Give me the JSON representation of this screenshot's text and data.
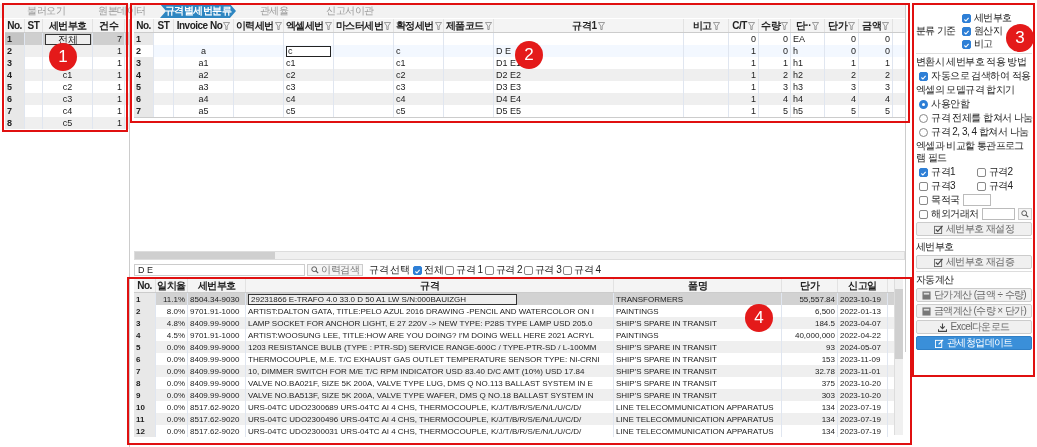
{
  "tabs": [
    {
      "label": "불러오기",
      "selected": false
    },
    {
      "label": "원본데이터",
      "selected": false
    },
    {
      "label": "규격별세번분류",
      "selected": true
    },
    {
      "label": "관세율",
      "selected": false
    },
    {
      "label": "신고서이관",
      "selected": false
    }
  ],
  "code_list": {
    "columns": [
      "No.",
      "ST",
      "세번부호",
      "건수"
    ],
    "rows": [
      {
        "no": "1",
        "code": "전체",
        "count": "7",
        "selected": true
      },
      {
        "no": "2",
        "count": "1",
        "selected": false
      },
      {
        "no": "3",
        "count": "1",
        "selected": false
      },
      {
        "no": "4",
        "code": "c1",
        "count": "1",
        "selected": false
      },
      {
        "no": "5",
        "code": "c2",
        "count": "1",
        "selected": false
      },
      {
        "no": "6",
        "code": "c3",
        "count": "1",
        "selected": false
      },
      {
        "no": "7",
        "code": "c4",
        "count": "1",
        "selected": false
      },
      {
        "no": "8",
        "code": "c5",
        "count": "1",
        "selected": false
      }
    ]
  },
  "items_table": {
    "columns": [
      {
        "label": "No.",
        "filter": false,
        "kind": "no"
      },
      {
        "label": "ST",
        "filter": false,
        "kind": "text"
      },
      {
        "label": "Invoice No",
        "filter": true,
        "kind": "center"
      },
      {
        "label": "이력세번",
        "filter": true,
        "kind": "text"
      },
      {
        "label": "엑셀세번",
        "filter": true,
        "kind": "edit"
      },
      {
        "label": "마스터세번",
        "filter": true,
        "kind": "text"
      },
      {
        "label": "확정세번",
        "filter": true,
        "kind": "text"
      },
      {
        "label": "제품코드",
        "filter": true,
        "kind": "text"
      },
      {
        "label": "규격1",
        "filter": true,
        "kind": "text"
      },
      {
        "label": "비고",
        "filter": true,
        "kind": "text"
      },
      {
        "label": "C/T",
        "filter": true,
        "kind": "number"
      },
      {
        "label": "수량",
        "filter": true,
        "kind": "number"
      },
      {
        "label": "단··",
        "filter": true,
        "kind": "text"
      },
      {
        "label": "단가",
        "filter": true,
        "kind": "number"
      },
      {
        "label": "금액",
        "filter": true,
        "kind": "number"
      }
    ],
    "rows": [
      {
        "selected": false,
        "cells": [
          "1",
          null,
          null,
          null,
          null,
          null,
          null,
          null,
          null,
          null,
          "0",
          "0",
          "EA",
          "0",
          "0"
        ]
      },
      {
        "selected": true,
        "cells": [
          "2",
          null,
          "a",
          null,
          "c",
          null,
          "c",
          null,
          "D E",
          null,
          "1",
          "0",
          "h",
          "0",
          "0"
        ]
      },
      {
        "selected": false,
        "cells": [
          "3",
          null,
          "a1",
          null,
          "c1",
          null,
          "c1",
          null,
          "D1 E1",
          null,
          "1",
          "1",
          "h1",
          "1",
          "1"
        ]
      },
      {
        "selected": false,
        "cells": [
          "4",
          null,
          "a2",
          null,
          "c2",
          null,
          "c2",
          null,
          "D2 E2",
          null,
          "1",
          "2",
          "h2",
          "2",
          "2"
        ]
      },
      {
        "selected": false,
        "cells": [
          "5",
          null,
          "a3",
          null,
          "c3",
          null,
          "c3",
          null,
          "D3 E3",
          null,
          "1",
          "3",
          "h3",
          "3",
          "3"
        ]
      },
      {
        "selected": false,
        "cells": [
          "6",
          null,
          "a4",
          null,
          "c4",
          null,
          "c4",
          null,
          "D4 E4",
          null,
          "1",
          "4",
          "h4",
          "4",
          "4"
        ]
      },
      {
        "selected": false,
        "cells": [
          "7",
          null,
          "a5",
          null,
          "c5",
          null,
          "c5",
          null,
          "D5 E5",
          null,
          "1",
          "5",
          "h5",
          "5",
          "5"
        ]
      }
    ]
  },
  "search": {
    "value": "D E",
    "button": "이력검색",
    "spec_label": "규격 선택",
    "spec_options": [
      {
        "label": "전체",
        "checked": true
      },
      {
        "label": "규격 1",
        "checked": false
      },
      {
        "label": "규격 2",
        "checked": false
      },
      {
        "label": "규격 3",
        "checked": false
      },
      {
        "label": "규격 4",
        "checked": false
      }
    ]
  },
  "history_table": {
    "columns": [
      {
        "label": "No.",
        "kind": "no"
      },
      {
        "label": "일치율",
        "kind": "number"
      },
      {
        "label": "세번부호",
        "kind": "text"
      },
      {
        "label": "규격",
        "kind": "text"
      },
      {
        "label": "품명",
        "kind": "text"
      },
      {
        "label": "단가",
        "kind": "number"
      },
      {
        "label": "신고일",
        "kind": "text"
      }
    ],
    "rows": [
      {
        "selected": true,
        "cells": [
          "1",
          "11.1%",
          "8504.34-9030",
          "29231866 E-TRAFO 4.0 33.0 D 50 A1 LW S/N:000BAUIZGH",
          "TRANSFORMERS",
          "55,557.84",
          "2023-10-19"
        ]
      },
      {
        "selected": false,
        "cells": [
          "2",
          "8.0%",
          "9701.91-1000",
          "ARTIST:DALTON GATA, TITLE:PELO AZUL 2016 DRAWING -PENCIL AND WATERCOLOR ON I",
          "PAINTINGS",
          "6,500",
          "2022-01-13"
        ]
      },
      {
        "selected": false,
        "cells": [
          "3",
          "4.8%",
          "8409.99-9000",
          "LAMP SOCKET FOR ANCHOR LIGHT, E 27 220V -> NEW TYPE: P28S TYPE LAMP USD 205.0",
          "SHIP'S SPARE IN TRANSIT",
          "184.5",
          "2023-04-07"
        ]
      },
      {
        "selected": false,
        "cells": [
          "4",
          "4.5%",
          "9701.91-1000",
          "ARTIST:WOOSUNG LEE, TITLE:HOW ARE YOU DOING? I'M DOING WELL HERE 2021 ACRYL",
          "PAINTINGS",
          "40,000,000",
          "2022-04-22"
        ]
      },
      {
        "selected": false,
        "cells": [
          "5",
          "0.0%",
          "8409.99-9000",
          "1203 RESISTANCE BULB (TYPE : PTR-SD) SERVICE RANGE-600C / TYPE-PTR-SD / L-100MM",
          "SHIP'S SPARE IN TRANSIT",
          "93",
          "2024-05-07"
        ]
      },
      {
        "selected": false,
        "cells": [
          "6",
          "0.0%",
          "8409.99-9000",
          "THERMOCOUPLE, M.E. T/C EXHAUST GAS OUTLET TEMPERATURE SENSOR TYPE: NI-CRNI",
          "SHIP'S SPARE IN TRANSIT",
          "153",
          "2023-11-09"
        ]
      },
      {
        "selected": false,
        "cells": [
          "7",
          "0.0%",
          "8409.99-9000",
          "10, DIMMER SWITCH FOR M/E T/C RPM INDICATOR USD 83.40 D/C AMT (10%) USD 17.84",
          "SHIP'S SPARE IN TRANSIT",
          "32.78",
          "2023-11-01"
        ]
      },
      {
        "selected": false,
        "cells": [
          "8",
          "0.0%",
          "8409.99-9000",
          "VALVE NO.BA021F, SIZE 5K 200A, VALVE TYPE LUG, DMS Q NO.113 BALLAST SYSTEM IN E",
          "SHIP'S SPARE IN TRANSIT",
          "375",
          "2023-10-20"
        ]
      },
      {
        "selected": false,
        "cells": [
          "9",
          "0.0%",
          "8409.99-9000",
          "VALVE NO.BA513F, SIZE 5K 200A, VALVE TYPE WAFER, DMS Q NO.18 BALLAST SYSTEM IN",
          "SHIP'S SPARE IN TRANSIT",
          "303",
          "2023-10-20"
        ]
      },
      {
        "selected": false,
        "cells": [
          "10",
          "0.0%",
          "8517.62-9020",
          "URS-04TC UDO2300689 URS-04TC AI 4 CHS, THERMOCOUPLE, K/J/T/B/R/S/E/N/L/U/C/D/",
          "LINE TELECOMMUNICATION APPARATUS",
          "134",
          "2023-07-19"
        ]
      },
      {
        "selected": false,
        "cells": [
          "11",
          "0.0%",
          "8517.62-9020",
          "URS-04TC UDO2300496 URS-04TC AI 4 CHS, THERMOCOUPLE, K/J/T/B/R/S/E/N/L/U/C/D/",
          "LINE TELECOMMUNICATION APPARATUS",
          "134",
          "2023-07-19"
        ]
      },
      {
        "selected": false,
        "cells": [
          "12",
          "0.0%",
          "8517.62-9020",
          "URS-04TC UDO2300031 URS-04TC AI 4 CHS, THERMOCOUPLE, K/J/T/B/R/S/E/N/L/U/C/D/",
          "LINE TELECOMMUNICATION APPARATUS",
          "134",
          "2023-07-19"
        ]
      }
    ]
  },
  "options_panel": {
    "criteria": {
      "label": "분류 기준",
      "options": [
        {
          "label": "세번부호",
          "checked": true
        },
        {
          "label": "원산지",
          "checked": true
        },
        {
          "label": "비고",
          "checked": true
        }
      ]
    },
    "apply_method": {
      "title": "변환시 세번부호 적용 방법",
      "option": {
        "label": "자동으로 검색하여 적용",
        "checked": true
      }
    },
    "merge": {
      "title": "엑셀의 모델규격 합치기",
      "options": [
        {
          "label": "사용안함",
          "selected": true
        },
        {
          "label": "규격 전체를 합쳐서 나눔",
          "selected": false
        },
        {
          "label": "규격 2, 3, 4 합쳐서 나눔",
          "selected": false
        }
      ]
    },
    "fields": {
      "title": "엑셀과 비교할 통관프로그램 필드",
      "options": [
        {
          "label": "규격1",
          "checked": true
        },
        {
          "label": "규격2",
          "checked": false
        },
        {
          "label": "규격3",
          "checked": false
        },
        {
          "label": "규격4",
          "checked": false
        }
      ],
      "destination": {
        "label": "목적국",
        "checked": false
      },
      "partner": {
        "label": "해외거래처",
        "checked": false
      },
      "button": "세번부호 재설정"
    },
    "code_section": {
      "title": "세번부호",
      "button": "세번부호 재검증"
    },
    "calc": {
      "title": "자동계산",
      "buttons": [
        {
          "label": "단가계산 (금액 ÷ 수량)",
          "kind": "calc"
        },
        {
          "label": "금액계산 (수량 × 단가)",
          "kind": "calc"
        },
        {
          "label": "Excel다운로드",
          "kind": "download"
        },
        {
          "label": "관세청업데이트",
          "kind": "primary"
        }
      ]
    }
  },
  "annotations": [
    {
      "label": "1"
    },
    {
      "label": "2"
    },
    {
      "label": "3"
    },
    {
      "label": "4"
    }
  ]
}
